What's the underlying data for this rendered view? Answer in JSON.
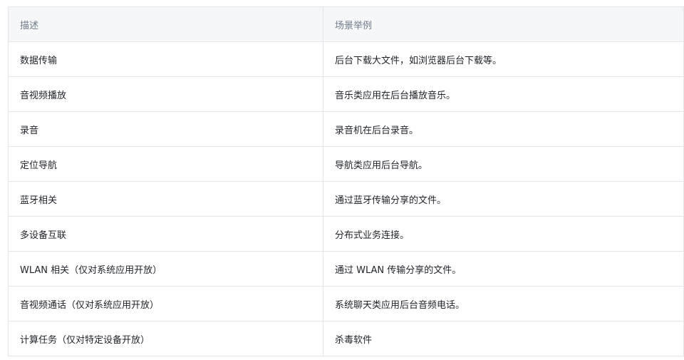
{
  "table": {
    "headers": [
      "描述",
      "场景举例"
    ],
    "rows": [
      [
        "数据传输",
        "后台下载大文件，如浏览器后台下载等。"
      ],
      [
        "音视频播放",
        "音乐类应用在后台播放音乐。"
      ],
      [
        "录音",
        "录音机在后台录音。"
      ],
      [
        "定位导航",
        "导航类应用后台导航。"
      ],
      [
        "蓝牙相关",
        "通过蓝牙传输分享的文件。"
      ],
      [
        "多设备互联",
        "分布式业务连接。"
      ],
      [
        "WLAN 相关（仅对系统应用开放）",
        "通过 WLAN 传输分享的文件。"
      ],
      [
        "音视频通话（仅对系统应用开放）",
        "系统聊天类应用后台音频电话。"
      ],
      [
        "计算任务（仅对特定设备开放）",
        "杀毒软件"
      ]
    ]
  }
}
